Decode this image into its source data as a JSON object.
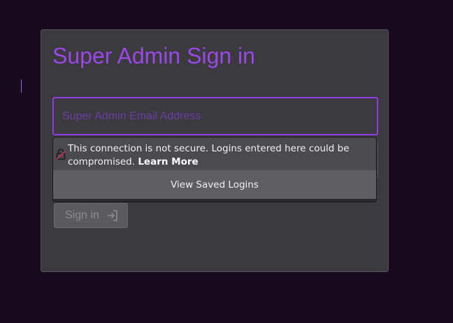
{
  "form": {
    "title": "Super Admin Sign in",
    "email_placeholder": "Super Admin Email Address",
    "email_value": "",
    "signin_label": "Sign in"
  },
  "autofill_popup": {
    "warning_text": "This connection is not secure. Logins entered here could be compromised.",
    "learn_more_label": "Learn More",
    "saved_logins_label": "View Saved Logins"
  },
  "icons": {
    "lock": "insecure-lock-icon",
    "signin": "sign-in-arrow-icon"
  },
  "colors": {
    "background": "#180b1f",
    "card": "#3a3a3f",
    "accent": "#9b48e6",
    "input_border": "#8e3de0"
  }
}
